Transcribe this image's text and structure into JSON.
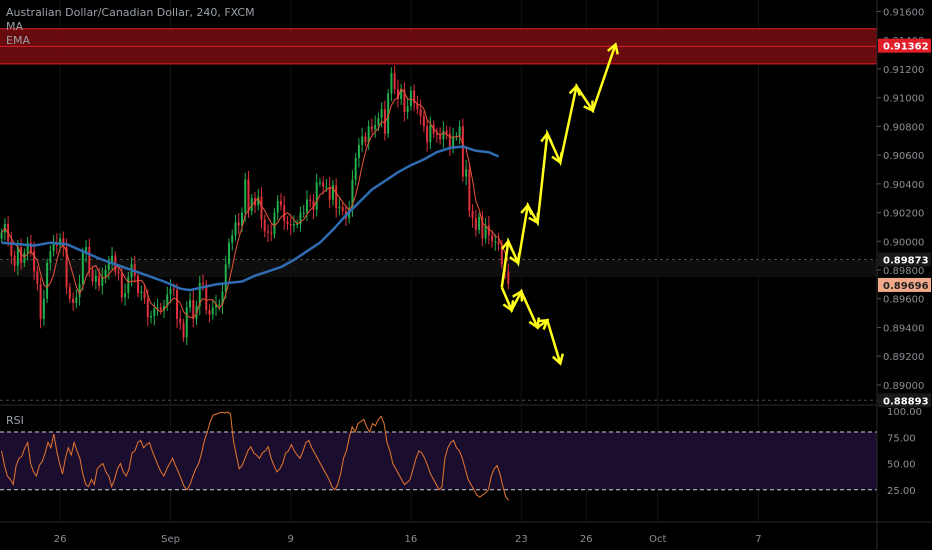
{
  "legend": {
    "title": "Australian Dollar/Canadian Dollar, 240, FXCM",
    "ma": "MA",
    "ema": "EMA"
  },
  "rsi": {
    "label": "RSI",
    "ticks": [
      "100.00",
      "75.00",
      "50.00",
      "25.00"
    ],
    "levels": [
      80,
      25
    ],
    "colors": {
      "line": "#e8772e",
      "band": "#1b0d2e",
      "level": "#cfcfcf"
    },
    "values": [
      62,
      48,
      38,
      35,
      30,
      48,
      55,
      57,
      65,
      70,
      50,
      42,
      38,
      48,
      52,
      60,
      70,
      65,
      78,
      62,
      50,
      40,
      55,
      65,
      58,
      70,
      62,
      55,
      40,
      30,
      28,
      35,
      30,
      45,
      48,
      50,
      42,
      38,
      28,
      35,
      45,
      50,
      42,
      38,
      45,
      60,
      62,
      70,
      72,
      65,
      68,
      70,
      62,
      55,
      48,
      42,
      38,
      45,
      50,
      55,
      48,
      42,
      35,
      28,
      25,
      30,
      38,
      45,
      50,
      60,
      72,
      80,
      90,
      96,
      97,
      98,
      99,
      98,
      99,
      97,
      72,
      58,
      45,
      48,
      55,
      62,
      66,
      60,
      58,
      55,
      60,
      62,
      66,
      55,
      48,
      42,
      45,
      50,
      60,
      62,
      68,
      62,
      58,
      55,
      62,
      70,
      72,
      65,
      60,
      55,
      50,
      45,
      40,
      35,
      28,
      25,
      30,
      40,
      55,
      62,
      75,
      85,
      80,
      88,
      90,
      92,
      85,
      80,
      88,
      86,
      92,
      95,
      88,
      70,
      62,
      50,
      45,
      40,
      35,
      30,
      32,
      35,
      45,
      55,
      62,
      60,
      55,
      48,
      40,
      35,
      30,
      25,
      28,
      55,
      65,
      70,
      72,
      65,
      62,
      55,
      45,
      35,
      30,
      25,
      20,
      18,
      20,
      22,
      25,
      38,
      45,
      48,
      40,
      28,
      18,
      15
    ]
  },
  "chart_data": {
    "type": "candlestick",
    "title": "Australian Dollar/Canadian Dollar, 240, FXCM",
    "indicators": [
      "MA",
      "EMA",
      "RSI"
    ],
    "y_ticks": [
      0.916,
      0.914,
      0.912,
      0.91,
      0.908,
      0.906,
      0.904,
      0.902,
      0.9,
      0.898,
      0.896,
      0.894,
      0.892,
      0.89
    ],
    "y_tick_labels": [
      "0.91600",
      "0.91400",
      "0.91200",
      "0.91000",
      "0.90800",
      "0.90600",
      "0.90400",
      "0.90200",
      "0.90000",
      "0.89800",
      "0.89600",
      "0.89400",
      "0.89200",
      "0.89000"
    ],
    "ylim": [
      0.8886,
      0.9168
    ],
    "x_labels": [
      "26",
      "Sep",
      "9",
      "16",
      "23",
      "26",
      "Oct",
      "7"
    ],
    "x_label_bars": [
      18,
      52,
      89,
      126,
      160,
      180,
      202,
      233
    ],
    "total_bars": 270,
    "price_tags": [
      {
        "label": "0.91362",
        "value": 0.91362,
        "color": "#e01e2a"
      },
      {
        "label": "0.89873",
        "value": 0.89873,
        "color": "#1a1a1a"
      },
      {
        "label": "0.89696",
        "value": 0.89696,
        "color": "#f2a98a"
      },
      {
        "label": "0.88893",
        "value": 0.88893,
        "color": "#1a1a1a"
      }
    ],
    "resistance_zone": {
      "low": 0.91235,
      "high": 0.9148
    },
    "series": [
      {
        "name": "Close",
        "values": [
          0.9006,
          0.9012,
          0.9,
          0.899,
          0.8983,
          0.8996,
          0.8985,
          0.8992,
          0.8999,
          0.8993,
          0.8979,
          0.897,
          0.8946,
          0.896,
          0.8985,
          0.8993,
          0.8999,
          0.8997,
          0.9002,
          0.8996,
          0.8968,
          0.896,
          0.8957,
          0.8961,
          0.897,
          0.8992,
          0.8996,
          0.898,
          0.8972,
          0.8976,
          0.8969,
          0.8975,
          0.898,
          0.8985,
          0.899,
          0.8979,
          0.8978,
          0.8961,
          0.8964,
          0.8975,
          0.8984,
          0.8976,
          0.8964,
          0.8965,
          0.896,
          0.8947,
          0.8948,
          0.8953,
          0.8954,
          0.8952,
          0.8955,
          0.8963,
          0.8967,
          0.8966,
          0.8946,
          0.8943,
          0.8933,
          0.8954,
          0.8959,
          0.8946,
          0.8955,
          0.8971,
          0.897,
          0.8952,
          0.8949,
          0.8954,
          0.8956,
          0.8956,
          0.8965,
          0.8984,
          0.8999,
          0.9004,
          0.9013,
          0.9011,
          0.902,
          0.9043,
          0.9021,
          0.903,
          0.9025,
          0.9031,
          0.9015,
          0.9007,
          0.9006,
          0.9005,
          0.902,
          0.9028,
          0.9025,
          0.9014,
          0.9012,
          0.9011,
          0.9012,
          0.9012,
          0.902,
          0.902,
          0.9029,
          0.9028,
          0.9022,
          0.9041,
          0.9041,
          0.9038,
          0.9038,
          0.9029,
          0.9039,
          0.9023,
          0.9024,
          0.9021,
          0.9016,
          0.9023,
          0.9043,
          0.9058,
          0.9067,
          0.9073,
          0.9069,
          0.908,
          0.9078,
          0.9081,
          0.9086,
          0.9092,
          0.9075,
          0.9103,
          0.9117,
          0.9106,
          0.9099,
          0.9106,
          0.909,
          0.9094,
          0.9105,
          0.9096,
          0.9092,
          0.9087,
          0.908,
          0.9069,
          0.9081,
          0.9075,
          0.9074,
          0.9071,
          0.9077,
          0.9075,
          0.9066,
          0.9073,
          0.9073,
          0.908,
          0.9045,
          0.905,
          0.9021,
          0.9016,
          0.9008,
          0.9017,
          0.9002,
          0.9011,
          0.9004,
          0.9,
          0.9,
          0.8998,
          0.8984,
          0.8979,
          0.897
        ]
      },
      {
        "name": "MA",
        "color": "#e8563a",
        "values": []
      },
      {
        "name": "EMA",
        "color": "#2f6db3",
        "points": [
          [
            0,
            0.8999
          ],
          [
            5,
            0.8998
          ],
          [
            10,
            0.8997
          ],
          [
            15,
            0.8999
          ],
          [
            20,
            0.8998
          ],
          [
            25,
            0.8993
          ],
          [
            30,
            0.8988
          ],
          [
            35,
            0.8984
          ],
          [
            40,
            0.898
          ],
          [
            45,
            0.8976
          ],
          [
            50,
            0.8972
          ],
          [
            55,
            0.8967
          ],
          [
            58,
            0.8966
          ],
          [
            62,
            0.8968
          ],
          [
            66,
            0.897
          ],
          [
            70,
            0.8971
          ],
          [
            74,
            0.8972
          ],
          [
            78,
            0.8976
          ],
          [
            82,
            0.8979
          ],
          [
            86,
            0.8982
          ],
          [
            90,
            0.8987
          ],
          [
            94,
            0.8993
          ],
          [
            98,
            0.8999
          ],
          [
            102,
            0.9008
          ],
          [
            106,
            0.9018
          ],
          [
            110,
            0.9027
          ],
          [
            114,
            0.9036
          ],
          [
            118,
            0.9042
          ],
          [
            122,
            0.9048
          ],
          [
            126,
            0.9053
          ],
          [
            130,
            0.9057
          ],
          [
            134,
            0.9062
          ],
          [
            138,
            0.9065
          ],
          [
            142,
            0.9066
          ],
          [
            146,
            0.9063
          ],
          [
            150,
            0.9062
          ],
          [
            153,
            0.9059
          ]
        ]
      }
    ],
    "annotations": {
      "arrow_color": "#ffff1a",
      "bullish_path": [
        [
          154,
          0.8968
        ],
        [
          156,
          0.9
        ],
        [
          159,
          0.8985
        ],
        [
          162,
          0.9025
        ],
        [
          165,
          0.9013
        ],
        [
          168,
          0.9075
        ],
        [
          172,
          0.9055
        ],
        [
          177,
          0.9108
        ],
        [
          182,
          0.9091
        ],
        [
          189,
          0.9137
        ]
      ],
      "bearish_path": [
        [
          154,
          0.8968
        ],
        [
          157,
          0.8952
        ],
        [
          160,
          0.8965
        ],
        [
          165,
          0.894
        ],
        [
          168,
          0.8945
        ],
        [
          172,
          0.8915
        ]
      ]
    },
    "colors": {
      "up": "#22b14c",
      "down": "#e0323c",
      "grid": "#303030",
      "axis_text": "#8a8f94",
      "zone_fill": "#7a0d12",
      "zone_line": "#e01e2a"
    }
  }
}
